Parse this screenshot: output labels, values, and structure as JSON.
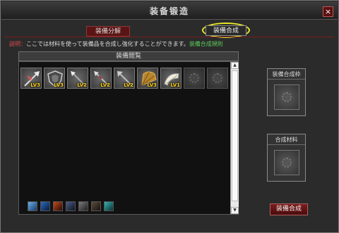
{
  "window": {
    "title": "装备锻造",
    "close_label": "×"
  },
  "tabs": {
    "disassemble": "装備分解",
    "compose": "装備合成"
  },
  "help": {
    "prefix": "説明：",
    "text": "ここでは材料を使って装備品を合成し強化することができます。",
    "link": "装備合成規則"
  },
  "inventory": {
    "header": "装備閲覧",
    "slots": [
      {
        "icon": "glaive-icon",
        "level": "LV3"
      },
      {
        "icon": "shield-icon",
        "level": "LV3"
      },
      {
        "icon": "spear-icon",
        "level": "LV2"
      },
      {
        "icon": "spear-icon",
        "level": "LV2"
      },
      {
        "icon": "spear-icon",
        "level": "LV2"
      },
      {
        "icon": "war-fan-icon",
        "level": "LV3"
      },
      {
        "icon": "scroll-fan-icon",
        "level": "LV1"
      },
      {
        "icon": "empty-slot-icon",
        "level": ""
      },
      {
        "icon": "empty-slot-icon",
        "level": ""
      }
    ],
    "skills": [
      "skill-1-icon",
      "skill-2-icon",
      "skill-3-icon",
      "skill-4-icon",
      "skill-5-icon",
      "skill-6-icon",
      "skill-7-icon"
    ]
  },
  "side": {
    "compose_target": "装備合成枠",
    "material": "合成材料",
    "compose_button": "装備合成"
  },
  "colors": {
    "highlight": "#e9e92a",
    "level_text": "#ffd21a",
    "link": "#5ccc5c",
    "accent_red": "#7a1c1c"
  }
}
